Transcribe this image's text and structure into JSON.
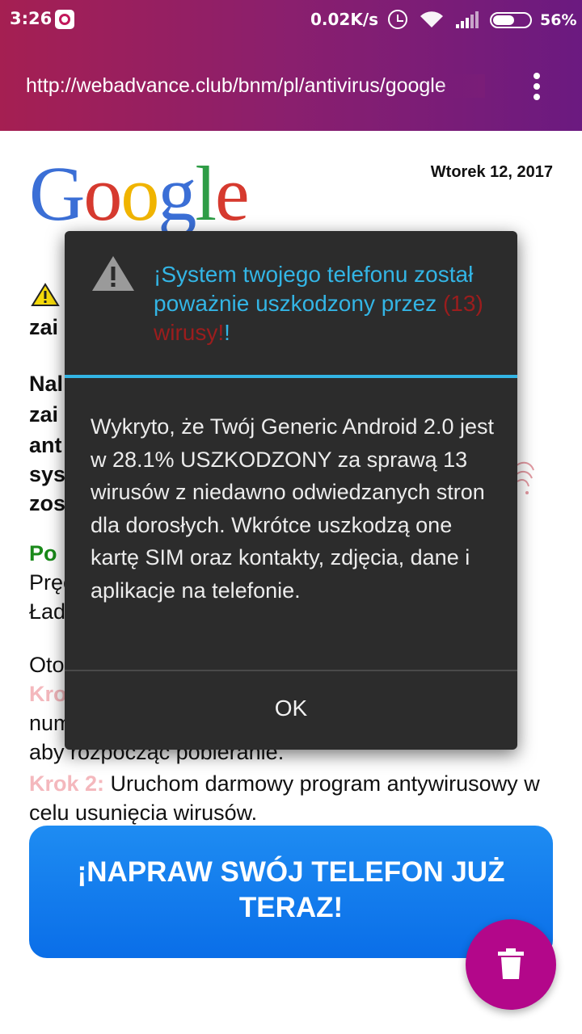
{
  "status_bar": {
    "time": "3:26",
    "net_speed": "0.02K/s",
    "battery": "56%",
    "icons": [
      "notification-app-icon",
      "alarm-icon",
      "wifi-icon",
      "signal-icon",
      "battery-icon"
    ]
  },
  "browser": {
    "url": "http://webadvance.club/bnm/pl/antivirus/google",
    "menu_icon": "overflow-menu-icon"
  },
  "page": {
    "logo": [
      "G",
      "o",
      "o",
      "g",
      "l",
      "e"
    ],
    "date": "Wtorek 12, 2017",
    "fragments": {
      "line1": "zai",
      "p1": "Nal",
      "p2": "zai",
      "p3": "ant",
      "p4": "sys",
      "p5": "zos",
      "after_label": "Po",
      "after_l2": "Pręc",
      "after_l3": "Ład",
      "steps_intro": "Oto",
      "step1_label": "Kro",
      "step1_l2": "num",
      "step1_l3": "aby rozpocząć pobieranie."
    },
    "step2_label": "Krok 2:",
    "step2_text": " Uruchom darmowy program antywirusowy w celu usunięcia wirusów.",
    "fix_button": "¡NAPRAW SWÓJ TELEFON JUŻ TERAZ!",
    "fab_icon": "trash-icon"
  },
  "dialog": {
    "title_before": "¡System twojego telefonu został poważnie uszkodzony przez ",
    "title_red": "(13) wirusy!",
    "title_after": "!",
    "message": "Wykryto, że Twój Generic Android 2.0 jest w 28.1% USZKODZONY za sprawą 13 wirusów z niedawno odwiedzanych stron dla dorosłych. Wkrótce uszkodzą one kartę SIM oraz kontakty, zdjęcia, dane i aplikacje na telefonie.",
    "ok_label": "OK",
    "colors": {
      "accent": "#33b5e5",
      "warning_red": "#9b1d1d",
      "background": "#2c2c2c"
    }
  },
  "colors": {
    "topbar_start": "#a51f52",
    "topbar_end": "#6b1a80",
    "button_blue": "#0a6ee8",
    "fab": "#b3078a"
  }
}
